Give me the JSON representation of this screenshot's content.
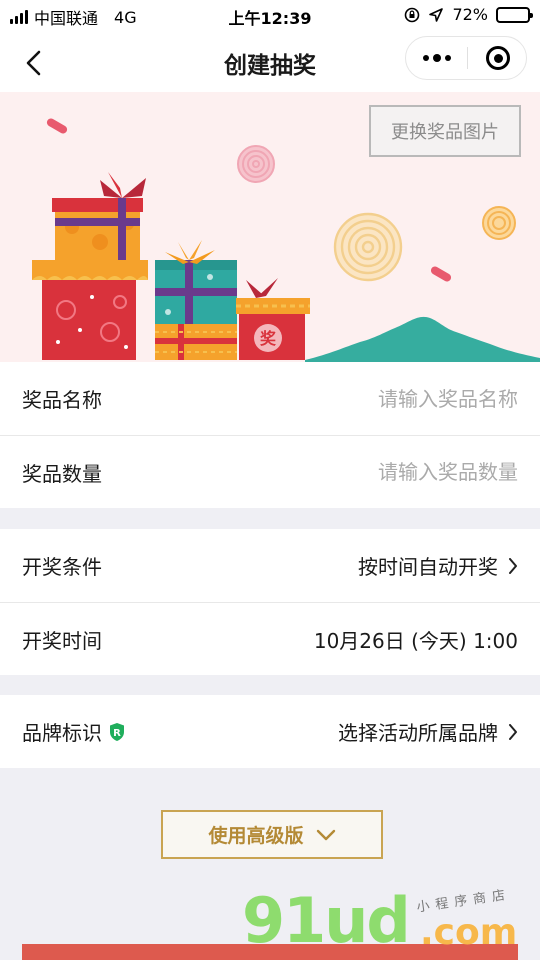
{
  "status_bar": {
    "carrier": "中国联通",
    "network": "4G",
    "time": "上午12:39",
    "battery_percent": "72%",
    "battery_level": 0.72
  },
  "nav": {
    "title": "创建抽奖",
    "back_icon": "chevron-left-icon",
    "more_icon": "more-dots-icon",
    "close_icon": "target-icon"
  },
  "banner": {
    "change_image_label": "更换奖品图片",
    "colors": {
      "background": "#fdf0f0",
      "gift_red": "#d9323c",
      "gift_orange": "#f5a22c",
      "gift_teal": "#2fa9a1",
      "ribbon_purple": "#6a3a8c",
      "hill_teal": "#36ad9f"
    }
  },
  "form": {
    "prize_name": {
      "label": "奖品名称",
      "placeholder": "请输入奖品名称",
      "value": ""
    },
    "prize_count": {
      "label": "奖品数量",
      "placeholder": "请输入奖品数量",
      "value": ""
    },
    "draw_condition": {
      "label": "开奖条件",
      "value": "按时间自动开奖"
    },
    "draw_time": {
      "label": "开奖时间",
      "value": "10月26日 (今天) 1:00"
    },
    "brand": {
      "label": "品牌标识",
      "badge_icon": "registered-shield-icon",
      "value": "选择活动所属品牌"
    }
  },
  "advanced_button": {
    "label": "使用高级版",
    "icon": "chevron-down-icon",
    "color": "#c9a452"
  },
  "watermark": {
    "main": "91ud",
    "suffix": ".com",
    "subtitle": "小程序商店"
  },
  "colors": {
    "accent_red": "#dd5a4e",
    "page_bg": "#efeff4"
  }
}
